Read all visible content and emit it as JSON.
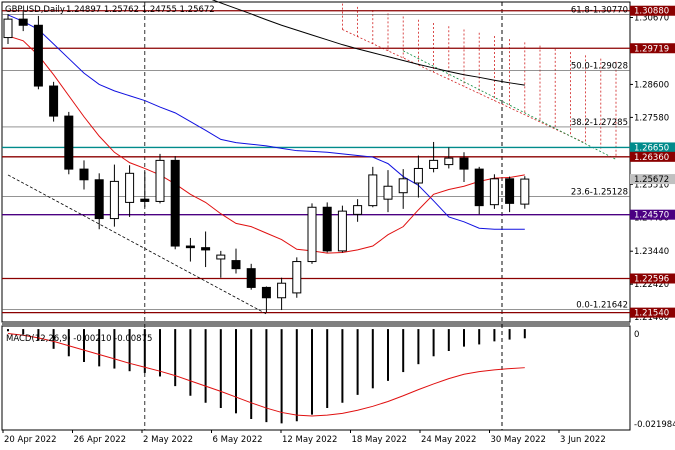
{
  "header": {
    "symbol_label": "GBPUSD,Daily",
    "ohlc": "1.24897 1.25762 1.24755 1.25672"
  },
  "indicator": {
    "label": "MACD(12,26,9) -0.00210 -0.00875",
    "scale_top": "0",
    "scale_bottom": "-0.021984"
  },
  "x_axis": {
    "labels": [
      "20 Apr 2022",
      "26 Apr 2022",
      "2 May 2022",
      "6 May 2022",
      "12 May 2022",
      "18 May 2022",
      "24 May 2022",
      "30 May 2022",
      "3 Jun 2022"
    ]
  },
  "y_axis": {
    "ticks": [
      "1.30670",
      "1.28600",
      "1.27580",
      "1.25510",
      "1.24490",
      "1.23440",
      "1.22420",
      "1.21400"
    ]
  },
  "price_tags": [
    {
      "price": 1.3088,
      "text": "1.30880",
      "bg": "#8b0000",
      "fg": "#ffffff"
    },
    {
      "price": 1.29719,
      "text": "1.29719",
      "bg": "#8b0000",
      "fg": "#ffffff"
    },
    {
      "price": 1.2665,
      "text": "1.26650",
      "bg": "#008b8b",
      "fg": "#ffffff"
    },
    {
      "price": 1.2636,
      "text": "1.26360",
      "bg": "#8b0000",
      "fg": "#ffffff"
    },
    {
      "price": 1.25672,
      "text": "1.25672",
      "bg": "#c0c0c0",
      "fg": "#000000"
    },
    {
      "price": 1.2457,
      "text": "1.24570",
      "bg": "#4b0082",
      "fg": "#ffffff"
    },
    {
      "price": 1.22596,
      "text": "1.22596",
      "bg": "#8b0000",
      "fg": "#ffffff"
    },
    {
      "price": 1.2154,
      "text": "1.21540",
      "bg": "#8b0000",
      "fg": "#ffffff"
    }
  ],
  "hlines": [
    {
      "price": 1.3088,
      "color": "#8b0000"
    },
    {
      "price": 1.29719,
      "color": "#8b0000"
    },
    {
      "price": 1.2665,
      "color": "#008b8b"
    },
    {
      "price": 1.2636,
      "color": "#8b0000"
    },
    {
      "price": 1.2457,
      "color": "#4b0082"
    },
    {
      "price": 1.22596,
      "color": "#8b0000"
    },
    {
      "price": 1.2154,
      "color": "#8b0000"
    }
  ],
  "fib_levels": [
    {
      "price": 1.3077,
      "text": "61.8-1.30770"
    },
    {
      "price": 1.29028,
      "text": "50.0-1.29028"
    },
    {
      "price": 1.27285,
      "text": "38.2-1.27285"
    },
    {
      "price": 1.25128,
      "text": "23.6-1.25128"
    },
    {
      "price": 1.21642,
      "text": "0.0-1.21642"
    }
  ],
  "colors": {
    "bull_candle": "#ffffff",
    "bear_candle": "#000000",
    "ma_red": "#e01010",
    "ma_blue": "#1010e0",
    "ma_black": "#000000",
    "ichimoku": "#d02020"
  },
  "chart_data": {
    "type": "candlestick",
    "price_range": [
      1.2125,
      1.3115
    ],
    "macd_range": [
      -0.023,
      0.0007
    ],
    "candles": [
      {
        "d": "19 Apr",
        "o": 1.3005,
        "h": 1.3077,
        "l": 1.2985,
        "c": 1.3062
      },
      {
        "d": "20 Apr",
        "o": 1.3062,
        "h": 1.3088,
        "l": 1.3025,
        "c": 1.3043
      },
      {
        "d": "21 Apr",
        "o": 1.3043,
        "h": 1.3072,
        "l": 1.2845,
        "c": 1.2855
      },
      {
        "d": "22 Apr",
        "o": 1.2855,
        "h": 1.2868,
        "l": 1.2745,
        "c": 1.2762
      },
      {
        "d": "25 Apr",
        "o": 1.2762,
        "h": 1.2775,
        "l": 1.2582,
        "c": 1.2598
      },
      {
        "d": "26 Apr",
        "o": 1.2598,
        "h": 1.2625,
        "l": 1.2535,
        "c": 1.2565
      },
      {
        "d": "27 Apr",
        "o": 1.2565,
        "h": 1.2585,
        "l": 1.2412,
        "c": 1.2445
      },
      {
        "d": "28 Apr",
        "o": 1.2445,
        "h": 1.2612,
        "l": 1.242,
        "c": 1.256
      },
      {
        "d": "29 Apr",
        "o": 1.2495,
        "h": 1.261,
        "l": 1.245,
        "c": 1.2585
      },
      {
        "d": "2 May",
        "o": 1.2505,
        "h": 1.259,
        "l": 1.248,
        "c": 1.2498
      },
      {
        "d": "3 May",
        "o": 1.2498,
        "h": 1.2645,
        "l": 1.2492,
        "c": 1.2625
      },
      {
        "d": "4 May",
        "o": 1.2625,
        "h": 1.2638,
        "l": 1.235,
        "c": 1.236
      },
      {
        "d": "5 May",
        "o": 1.236,
        "h": 1.2385,
        "l": 1.2312,
        "c": 1.2355
      },
      {
        "d": "6 May",
        "o": 1.2355,
        "h": 1.2405,
        "l": 1.2295,
        "c": 1.2348
      },
      {
        "d": "9 May",
        "o": 1.232,
        "h": 1.2345,
        "l": 1.2262,
        "c": 1.2332
      },
      {
        "d": "10 May",
        "o": 1.2315,
        "h": 1.2352,
        "l": 1.2275,
        "c": 1.229
      },
      {
        "d": "11 May",
        "o": 1.229,
        "h": 1.2305,
        "l": 1.2225,
        "c": 1.2232
      },
      {
        "d": "12 May",
        "o": 1.2232,
        "h": 1.2235,
        "l": 1.2155,
        "c": 1.22
      },
      {
        "d": "13 May",
        "o": 1.22,
        "h": 1.2262,
        "l": 1.2162,
        "c": 1.2245
      },
      {
        "d": "16 May",
        "o": 1.2215,
        "h": 1.2325,
        "l": 1.22,
        "c": 1.2312
      },
      {
        "d": "17 May",
        "o": 1.2312,
        "h": 1.2492,
        "l": 1.2305,
        "c": 1.248
      },
      {
        "d": "18 May",
        "o": 1.248,
        "h": 1.2495,
        "l": 1.234,
        "c": 1.2345
      },
      {
        "d": "19 May",
        "o": 1.2345,
        "h": 1.2485,
        "l": 1.234,
        "c": 1.2468
      },
      {
        "d": "20 May",
        "o": 1.2458,
        "h": 1.2505,
        "l": 1.2435,
        "c": 1.2485
      },
      {
        "d": "23 May",
        "o": 1.2485,
        "h": 1.2605,
        "l": 1.248,
        "c": 1.258
      },
      {
        "d": "24 May",
        "o": 1.2505,
        "h": 1.2595,
        "l": 1.2465,
        "c": 1.2545
      },
      {
        "d": "25 May",
        "o": 1.2525,
        "h": 1.2598,
        "l": 1.2475,
        "c": 1.2568
      },
      {
        "d": "26 May",
        "o": 1.2555,
        "h": 1.264,
        "l": 1.251,
        "c": 1.26
      },
      {
        "d": "27 May",
        "o": 1.26,
        "h": 1.2682,
        "l": 1.2588,
        "c": 1.2625
      },
      {
        "d": "30 May",
        "o": 1.2612,
        "h": 1.2665,
        "l": 1.26,
        "c": 1.2632
      },
      {
        "d": "31 May",
        "o": 1.2632,
        "h": 1.265,
        "l": 1.2558,
        "c": 1.2598
      },
      {
        "d": "1 Jun",
        "o": 1.2598,
        "h": 1.2605,
        "l": 1.2458,
        "c": 1.2485
      },
      {
        "d": "2 Jun",
        "o": 1.2488,
        "h": 1.2582,
        "l": 1.2475,
        "c": 1.2568
      },
      {
        "d": "3 Jun",
        "o": 1.2568,
        "h": 1.2575,
        "l": 1.2465,
        "c": 1.2492
      },
      {
        "d": "6 Jun",
        "o": 1.24897,
        "h": 1.25762,
        "l": 1.24755,
        "c": 1.25672
      }
    ],
    "ma_black": [
      1.3385,
      1.3365,
      1.3345,
      1.3325,
      1.3305,
      1.3285,
      1.3265,
      1.3245,
      1.3225,
      1.3205,
      1.3185,
      1.3165,
      1.3148,
      1.313,
      1.3112,
      1.3095,
      1.3078,
      1.306,
      1.3043,
      1.3028,
      1.3013,
      1.2998,
      1.2983,
      1.297,
      1.2958,
      1.2946,
      1.2934,
      1.2922,
      1.2911,
      1.29,
      1.289,
      1.2882,
      1.2873,
      1.2865,
      1.2858
    ],
    "ma_blue": [
      1.3075,
      1.3055,
      1.303,
      1.2985,
      1.294,
      1.2895,
      1.286,
      1.284,
      1.2825,
      1.281,
      1.279,
      1.2772,
      1.2745,
      1.2718,
      1.269,
      1.268,
      1.2675,
      1.267,
      1.2662,
      1.2655,
      1.2653,
      1.265,
      1.2645,
      1.264,
      1.2635,
      1.2615,
      1.2575,
      1.2548,
      1.25,
      1.245,
      1.2435,
      1.2415,
      1.2412,
      1.2412,
      1.2412
    ],
    "ma_red": [
      1.301,
      1.2995,
      1.295,
      1.289,
      1.2825,
      1.276,
      1.27,
      1.265,
      1.2618,
      1.26,
      1.258,
      1.2552,
      1.252,
      1.2495,
      1.246,
      1.243,
      1.242,
      1.24,
      1.238,
      1.235,
      1.2345,
      1.2338,
      1.234,
      1.2348,
      1.236,
      1.2395,
      1.242,
      1.2472,
      1.252,
      1.2535,
      1.2545,
      1.256,
      1.257,
      1.2572,
      1.258
    ],
    "macd_hist": [
      -0.0005,
      -0.0012,
      -0.0025,
      -0.0045,
      -0.0062,
      -0.0075,
      -0.0085,
      -0.009,
      -0.0096,
      -0.01,
      -0.0108,
      -0.013,
      -0.0152,
      -0.0168,
      -0.018,
      -0.0192,
      -0.0205,
      -0.0212,
      -0.0215,
      -0.021,
      -0.0195,
      -0.018,
      -0.0168,
      -0.015,
      -0.0135,
      -0.0118,
      -0.0098,
      -0.008,
      -0.0062,
      -0.005,
      -0.004,
      -0.0035,
      -0.0028,
      -0.0024,
      -0.0021
    ],
    "macd_signal": [
      -0.001,
      -0.0014,
      -0.002,
      -0.0028,
      -0.0038,
      -0.0048,
      -0.0058,
      -0.0068,
      -0.0078,
      -0.0087,
      -0.0096,
      -0.0106,
      -0.0118,
      -0.013,
      -0.0142,
      -0.0155,
      -0.0168,
      -0.018,
      -0.019,
      -0.0196,
      -0.0198,
      -0.0196,
      -0.0192,
      -0.0185,
      -0.0176,
      -0.0165,
      -0.0152,
      -0.0138,
      -0.0125,
      -0.0113,
      -0.0103,
      -0.0097,
      -0.0093,
      -0.009,
      -0.0088
    ]
  }
}
